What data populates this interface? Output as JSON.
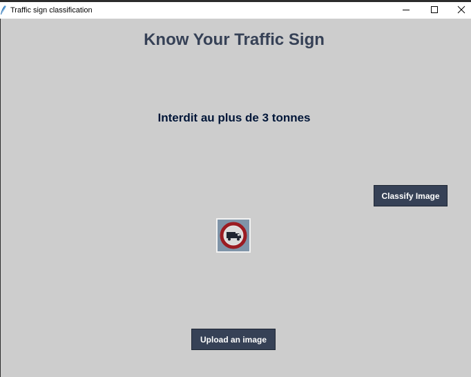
{
  "window": {
    "title": "Traffic sign classification",
    "controls": {
      "minimize": "minimize-icon",
      "maximize": "maximize-icon",
      "close": "close-icon"
    }
  },
  "app": {
    "heading": "Know Your Traffic Sign",
    "result_label": "Interdit au plus de 3 tonnes",
    "classify_button": "Classify Image",
    "upload_button": "Upload an image",
    "image_icon": "no-trucks-sign-icon"
  },
  "colors": {
    "background": "#cdcdcd",
    "heading": "#364156",
    "result_text": "#011638",
    "button_bg": "#364156",
    "button_text": "#ffffff"
  }
}
